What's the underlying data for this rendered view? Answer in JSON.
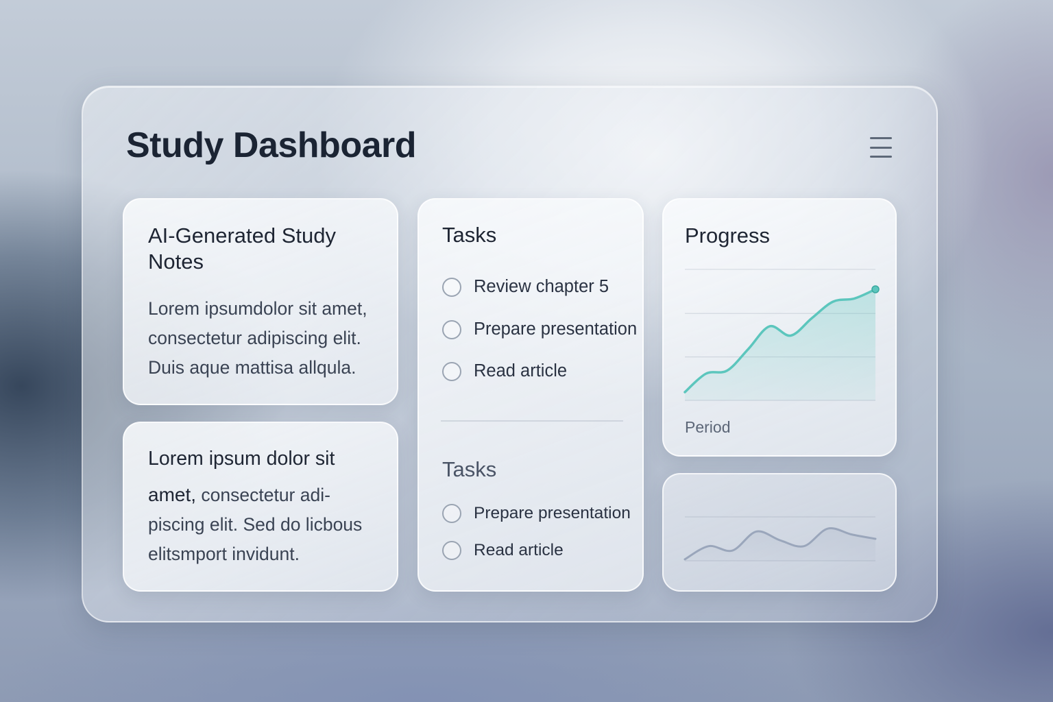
{
  "header": {
    "title": "Study Dashboard",
    "menu_icon": "hamburger-menu-icon"
  },
  "notes": [
    {
      "title_lines": [
        "AI-Generated Study",
        "Notes"
      ],
      "body_lines": [
        "Lorem ipsumdolor sit amet,",
        "consectetur adipiscing elit.",
        "Duis aque mattisa allqula."
      ]
    },
    {
      "lead": "Lorem ipsum dolor sit",
      "lead_bold": "amet,",
      "body_first": " consectetur adi-",
      "body_lines": [
        "piscing elit. Sed do licbous",
        "elitsmport invidunt."
      ]
    }
  ],
  "tasks": {
    "heading": "Tasks",
    "items": [
      {
        "label": "Review chapter 5",
        "checked": false
      },
      {
        "label": "Prepare presentation",
        "checked": false
      },
      {
        "label": "Read article",
        "checked": false
      }
    ],
    "secondary_heading": "Tasks",
    "secondary_items": [
      {
        "label": "Prepare presentation",
        "checked": false
      },
      {
        "label": "Read article",
        "checked": false
      }
    ]
  },
  "progress": {
    "title": "Progress",
    "xlabel": "Period",
    "accent_color": "#5cc6bd"
  },
  "chart_data": [
    {
      "type": "area",
      "title": "Progress",
      "xlabel": "Period",
      "ylabel": "",
      "x": [
        0,
        1,
        2,
        3,
        4,
        5,
        6,
        7,
        8,
        9
      ],
      "values": [
        8,
        26,
        29,
        50,
        72,
        63,
        80,
        96,
        99,
        108
      ],
      "ylim": [
        0,
        128
      ],
      "xlim": [
        0,
        9
      ],
      "grid": true,
      "color": "#5cc6bd"
    },
    {
      "type": "area",
      "x": [
        0,
        1,
        2,
        3,
        4,
        5,
        6,
        7,
        8
      ],
      "values": [
        2,
        20,
        14,
        40,
        28,
        20,
        44,
        36,
        30
      ],
      "ylim": [
        0,
        60
      ],
      "xlim": [
        0,
        8
      ],
      "grid": true,
      "color": "#9aa6bb"
    }
  ]
}
